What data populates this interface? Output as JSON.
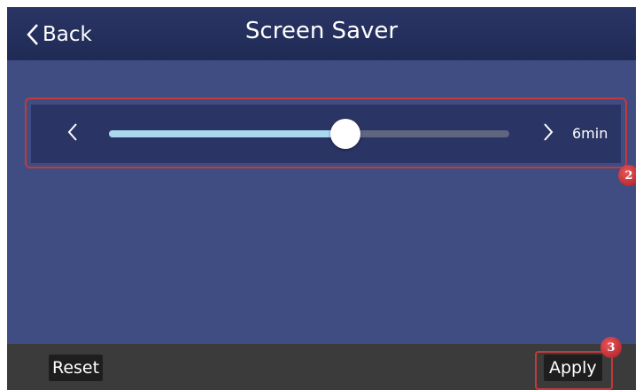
{
  "header": {
    "back_label": "Back",
    "title": "Screen Saver"
  },
  "slider": {
    "value_label": "6min",
    "level_fraction": 0.59,
    "decrease_icon": "chevron-left-icon",
    "increase_icon": "chevron-right-icon"
  },
  "badges": {
    "slider_badge": "2",
    "apply_badge": "3"
  },
  "footer": {
    "reset_label": "Reset",
    "apply_label": "Apply"
  },
  "colors": {
    "header_bg": "#1f2a55",
    "content_bg": "#3f4d82",
    "panel_bg": "#2a3565",
    "track_fill": "#a9d8ef",
    "track_rest": "#5f6680",
    "footer_bg": "#3b3b3b",
    "highlight": "#c23a3a"
  }
}
